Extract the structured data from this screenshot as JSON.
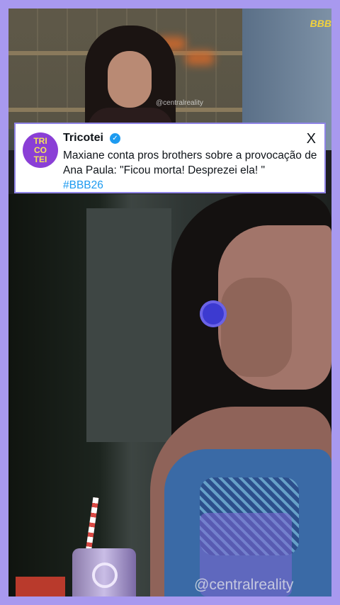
{
  "tweet": {
    "avatar_text": "TRI CO TEI",
    "author": "Tricotei",
    "verified_symbol": "✓",
    "platform_icon": "X",
    "text": "Maxiane conta pros brothers sobre a provocação de Ana Paula: \"Ficou morta! Desprezei ela! \"",
    "hashtag": "#BBB26"
  },
  "video": {
    "logo": "BBB",
    "watermark_top": "@centralreality",
    "watermark_main": "@centralreality"
  },
  "colors": {
    "border": "#a899ef",
    "accent": "#8a3fd6",
    "link": "#1d9bf0",
    "logo": "#f2d23c"
  }
}
